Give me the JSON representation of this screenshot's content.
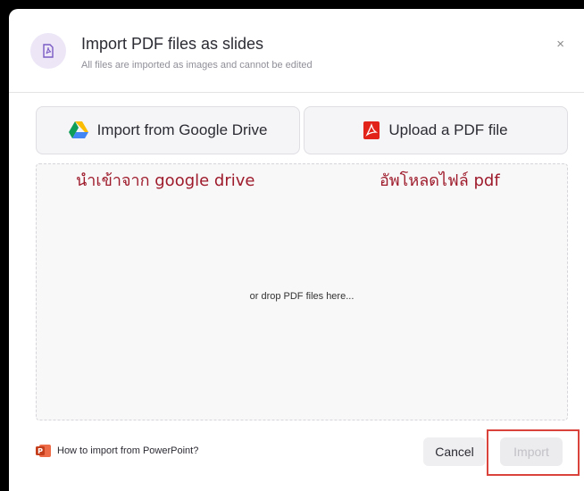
{
  "dialog": {
    "title": "Import PDF files as slides",
    "subtitle": "All files are imported as images and cannot be edited",
    "close_glyph": "×",
    "header_icon": "pdf-file-icon"
  },
  "sources": {
    "google": {
      "label": "Import from Google Drive",
      "icon": "google-drive-icon"
    },
    "upload": {
      "label": "Upload a PDF file",
      "icon": "pdf-icon"
    }
  },
  "dropzone": {
    "text": "or drop PDF files here..."
  },
  "annotations": {
    "google_note": "นำเข้าจาก google drive",
    "upload_note": "อัพโหลดไฟล์ pdf",
    "highlight_color": "#d9433c",
    "note_color": "#9e1b2b"
  },
  "footer": {
    "help_link": "How to import from PowerPoint?",
    "help_icon": "powerpoint-icon",
    "cancel_label": "Cancel",
    "import_label": "Import"
  }
}
